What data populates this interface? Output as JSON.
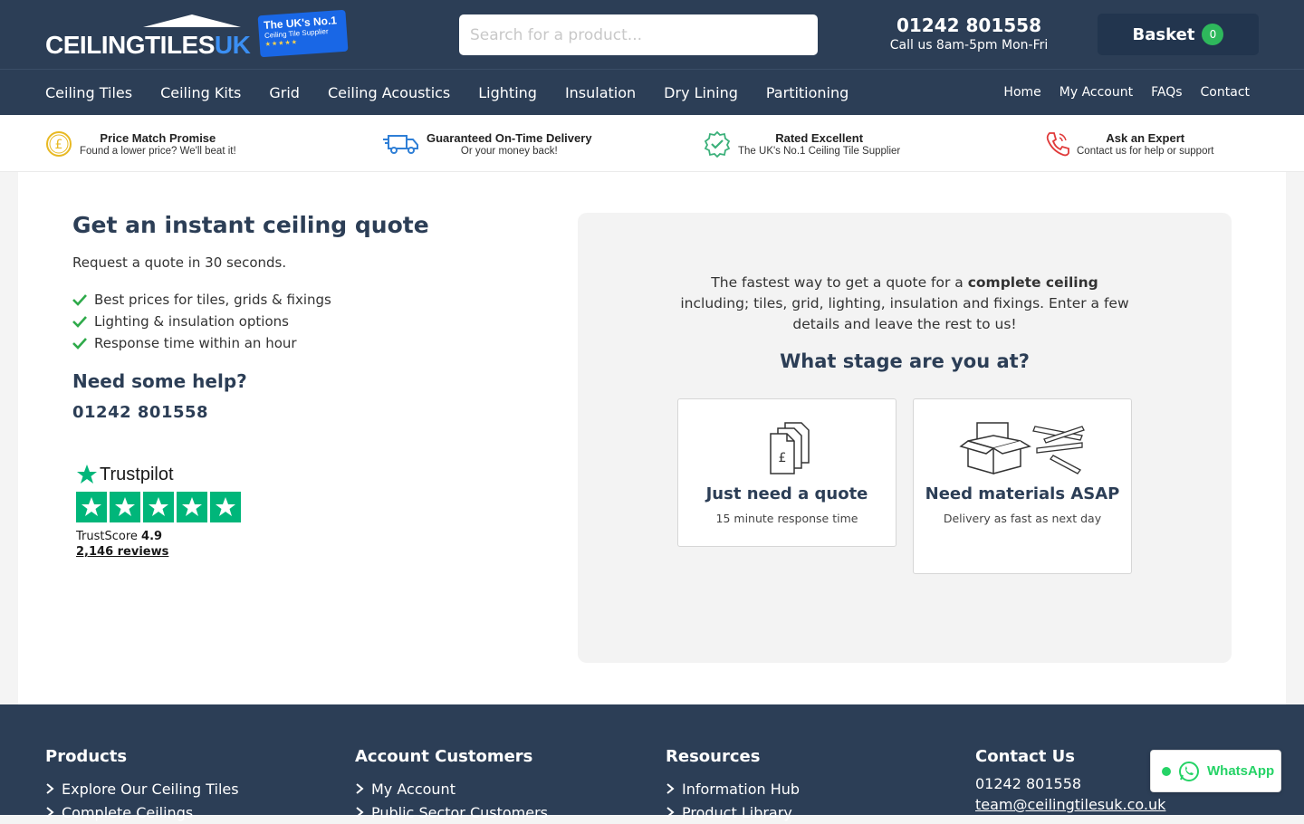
{
  "header": {
    "logo": {
      "main": "CEILINGTILES",
      "suffix": "UK"
    },
    "badge": {
      "line1": "The UK's No.1",
      "line2": "Ceiling Tile Supplier",
      "stars": "★★★★★"
    },
    "search_placeholder": "Search for a product...",
    "phone": "01242 801558",
    "hours": "Call us 8am-5pm Mon-Fri",
    "basket_label": "Basket",
    "basket_count": "0"
  },
  "nav": {
    "main": [
      "Ceiling Tiles",
      "Ceiling Kits",
      "Grid",
      "Ceiling Acoustics",
      "Lighting",
      "Insulation",
      "Dry Lining",
      "Partitioning"
    ],
    "right": [
      "Home",
      "My Account",
      "FAQs",
      "Contact"
    ]
  },
  "usp": [
    {
      "title": "Price Match Promise",
      "sub": "Found a lower price? We'll beat it!",
      "icon": "pound-coin-icon"
    },
    {
      "title": "Guaranteed On-Time Delivery",
      "sub": "Or your money back!",
      "icon": "delivery-truck-icon"
    },
    {
      "title": "Rated Excellent",
      "sub": "The UK's No.1 Ceiling Tile Supplier",
      "icon": "verified-badge-icon"
    },
    {
      "title": "Ask an Expert",
      "sub": "Contact us for help or support",
      "icon": "phone-icon"
    }
  ],
  "left": {
    "title": "Get an instant ceiling quote",
    "subtitle": "Request a quote in 30 seconds.",
    "bullets": [
      "Best prices for tiles, grids & fixings",
      "Lighting & insulation options",
      "Response time within an hour"
    ],
    "help_title": "Need some help?",
    "help_phone": "01242 801558"
  },
  "trustpilot": {
    "brand": "Trustpilot",
    "score_label": "TrustScore",
    "score": "4.9",
    "reviews": "2,146 reviews",
    "rating_stars": 5,
    "color": "#00b67a"
  },
  "panel": {
    "intro_pre": "The fastest way to get a quote for a ",
    "intro_bold": "complete ceiling",
    "intro_post": " including; tiles, grid, lighting, insulation and fixings. Enter a few details and leave the rest to us!",
    "question": "What stage are you at?",
    "options": [
      {
        "title": "Just need a quote",
        "sub": "15 minute response time",
        "icon": "documents-pound-icon"
      },
      {
        "title": "Need materials ASAP",
        "sub": "Delivery as fast as next day",
        "icon": "box-materials-icon"
      }
    ]
  },
  "footer": {
    "columns": [
      {
        "heading": "Products",
        "links": [
          "Explore Our Ceiling Tiles",
          "Complete Ceilings"
        ]
      },
      {
        "heading": "Account Customers",
        "links": [
          "My Account",
          "Public Sector Customers"
        ]
      },
      {
        "heading": "Resources",
        "links": [
          "Information Hub",
          "Product Library"
        ]
      }
    ],
    "contact": {
      "heading": "Contact Us",
      "phone": "01242 801558",
      "email": "team@ceilingtilesuk.co.uk"
    }
  },
  "whatsapp": {
    "label": "WhatsApp"
  },
  "colors": {
    "navy": "#2c3e56",
    "accent_blue": "#3b8ff3",
    "green": "#2eb85c",
    "trustpilot": "#00b67a",
    "whatsapp": "#25d366"
  }
}
